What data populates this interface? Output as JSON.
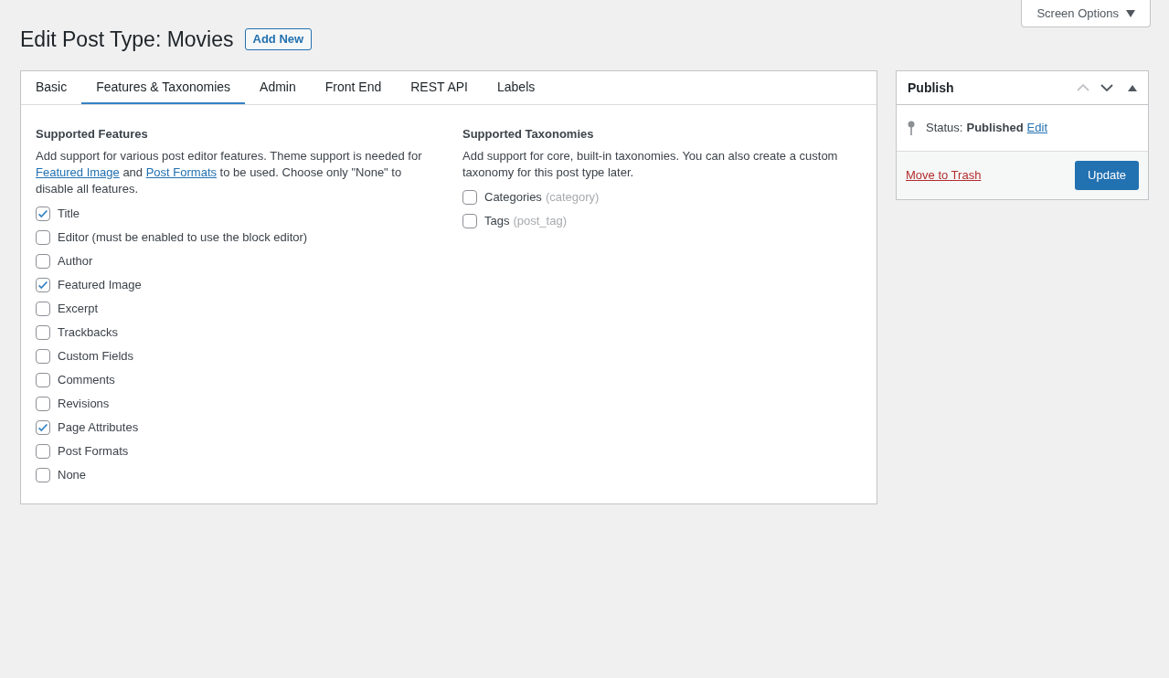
{
  "screen_options": {
    "label": "Screen Options",
    "expanded": false
  },
  "page_title": "Edit Post Type: Movies",
  "add_new_button": "Add New",
  "tabs": [
    {
      "label": "Basic",
      "selected": false
    },
    {
      "label": "Features & Taxonomies",
      "selected": true
    },
    {
      "label": "Admin",
      "selected": false
    },
    {
      "label": "Front End",
      "selected": false
    },
    {
      "label": "REST API",
      "selected": false
    },
    {
      "label": "Labels",
      "selected": false
    }
  ],
  "features": {
    "heading": "Supported Features",
    "description": [
      {
        "kind": "text",
        "text": "Add support for various post editor features. Theme support is needed for "
      },
      {
        "kind": "link",
        "text": "Featured Image"
      },
      {
        "kind": "text",
        "text": " and "
      },
      {
        "kind": "link",
        "text": "Post Formats"
      },
      {
        "kind": "text",
        "text": " to be used. Choose only \"None\" to disable all features."
      }
    ],
    "options": [
      {
        "label": "Title",
        "checked": true
      },
      {
        "label": "Editor (must be enabled to use the block editor)",
        "checked": false
      },
      {
        "label": "Author",
        "checked": false
      },
      {
        "label": "Featured Image",
        "checked": true
      },
      {
        "label": "Excerpt",
        "checked": false
      },
      {
        "label": "Trackbacks",
        "checked": false
      },
      {
        "label": "Custom Fields",
        "checked": false
      },
      {
        "label": "Comments",
        "checked": false
      },
      {
        "label": "Revisions",
        "checked": false
      },
      {
        "label": "Page Attributes",
        "checked": true
      },
      {
        "label": "Post Formats",
        "checked": false
      },
      {
        "label": "None",
        "checked": false
      }
    ]
  },
  "taxonomies": {
    "heading": "Supported Taxonomies",
    "description": "Add support for core, built-in taxonomies. You can also create a custom taxonomy for this post type later.",
    "options": [
      {
        "label": "Categories",
        "slug": "(category)",
        "checked": false
      },
      {
        "label": "Tags",
        "slug": "(post_tag)",
        "checked": false
      }
    ]
  },
  "publish": {
    "title": "Publish",
    "move_up_disabled": true,
    "move_down_disabled": false,
    "expanded": true,
    "status_label": "Status:",
    "status_value": "Published",
    "edit_link": "Edit",
    "trash_link": "Move to Trash",
    "update_button": "Update"
  }
}
